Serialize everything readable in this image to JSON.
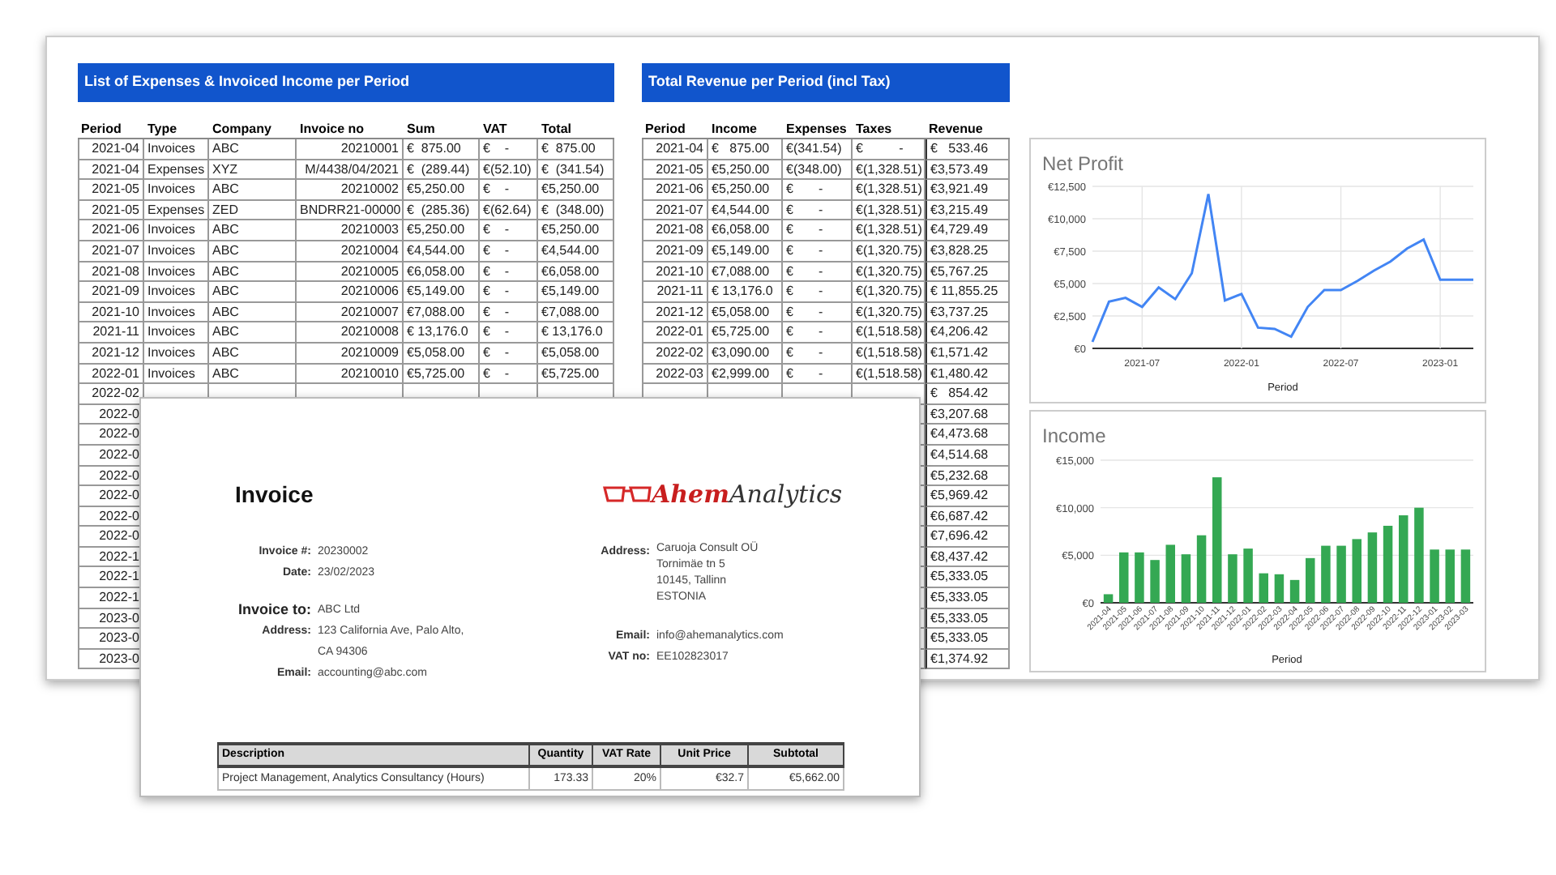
{
  "expenses": {
    "title": "List of Expenses & Invoiced Income per Period",
    "columns": [
      "Period",
      "Type",
      "Company",
      "Invoice no",
      "Sum",
      "VAT",
      "Total"
    ],
    "rows": [
      [
        "2021-04",
        "Invoices",
        "ABC",
        "20210001",
        "€  875.00",
        "€    -",
        "€  875.00"
      ],
      [
        "2021-04",
        "Expenses",
        "XYZ",
        "M/4438/04/2021",
        "€  (289.44)",
        "€(52.10)",
        "€  (341.54)"
      ],
      [
        "2021-05",
        "Invoices",
        "ABC",
        "20210002",
        "€5,250.00",
        "€    -",
        "€5,250.00"
      ],
      [
        "2021-05",
        "Expenses",
        "ZED",
        "BNDRR21-00000",
        "€  (285.36)",
        "€(62.64)",
        "€  (348.00)"
      ],
      [
        "2021-06",
        "Invoices",
        "ABC",
        "20210003",
        "€5,250.00",
        "€    -",
        "€5,250.00"
      ],
      [
        "2021-07",
        "Invoices",
        "ABC",
        "20210004",
        "€4,544.00",
        "€    -",
        "€4,544.00"
      ],
      [
        "2021-08",
        "Invoices",
        "ABC",
        "20210005",
        "€6,058.00",
        "€    -",
        "€6,058.00"
      ],
      [
        "2021-09",
        "Invoices",
        "ABC",
        "20210006",
        "€5,149.00",
        "€    -",
        "€5,149.00"
      ],
      [
        "2021-10",
        "Invoices",
        "ABC",
        "20210007",
        "€7,088.00",
        "€    -",
        "€7,088.00"
      ],
      [
        "2021-11",
        "Invoices",
        "ABC",
        "20210008",
        "€ 13,176.0",
        "€    -",
        "€ 13,176.0"
      ],
      [
        "2021-12",
        "Invoices",
        "ABC",
        "20210009",
        "€5,058.00",
        "€    -",
        "€5,058.00"
      ],
      [
        "2022-01",
        "Invoices",
        "ABC",
        "20210010",
        "€5,725.00",
        "€    -",
        "€5,725.00"
      ]
    ],
    "tail_periods": [
      "2022-02",
      "2022-0",
      "2022-0",
      "2022-0",
      "2022-0",
      "2022-0",
      "2022-0",
      "2022-0",
      "2022-1",
      "2022-1",
      "2022-1",
      "2023-0",
      "2023-0",
      "2023-0"
    ]
  },
  "revenue": {
    "title": "Total Revenue per Period (incl Tax)",
    "columns": [
      "Period",
      "Income",
      "Expenses",
      "Taxes",
      "Revenue"
    ],
    "rows": [
      [
        "2021-04",
        "€   875.00",
        "€(341.54)",
        "€          -",
        "€   533.46"
      ],
      [
        "2021-05",
        "€5,250.00",
        "€(348.00)",
        "€(1,328.51)",
        "€3,573.49"
      ],
      [
        "2021-06",
        "€5,250.00",
        "€       -",
        "€(1,328.51)",
        "€3,921.49"
      ],
      [
        "2021-07",
        "€4,544.00",
        "€       -",
        "€(1,328.51)",
        "€3,215.49"
      ],
      [
        "2021-08",
        "€6,058.00",
        "€       -",
        "€(1,328.51)",
        "€4,729.49"
      ],
      [
        "2021-09",
        "€5,149.00",
        "€       -",
        "€(1,320.75)",
        "€3,828.25"
      ],
      [
        "2021-10",
        "€7,088.00",
        "€       -",
        "€(1,320.75)",
        "€5,767.25"
      ],
      [
        "2021-11",
        "€ 13,176.0",
        "€       -",
        "€(1,320.75)",
        "€ 11,855.25"
      ],
      [
        "2021-12",
        "€5,058.00",
        "€       -",
        "€(1,320.75)",
        "€3,737.25"
      ],
      [
        "2022-01",
        "€5,725.00",
        "€       -",
        "€(1,518.58)",
        "€4,206.42"
      ],
      [
        "2022-02",
        "€3,090.00",
        "€       -",
        "€(1,518.58)",
        "€1,571.42"
      ],
      [
        "2022-03",
        "€2,999.00",
        "€       -",
        "€(1,518.58)",
        "€1,480.42"
      ]
    ],
    "tail_revenues": [
      "€   854.42",
      "€3,207.68",
      "€4,473.68",
      "€4,514.68",
      "€5,232.68",
      "€5,969.42",
      "€6,687.42",
      "€7,696.42",
      "€8,437.42",
      "€5,333.05",
      "€5,333.05",
      "€5,333.05",
      "€5,333.05",
      "€1,374.92"
    ]
  },
  "charts": [
    {
      "chart_data": {
        "type": "line",
        "grid": true,
        "title": "Net Profit",
        "xlabel": "Period",
        "categories": [
          null,
          null,
          null,
          "2021-07",
          null,
          null,
          null,
          null,
          null,
          "2022-01",
          null,
          null,
          null,
          null,
          null,
          "2022-07",
          null,
          null,
          null,
          null,
          null,
          "2023-01",
          null,
          null
        ],
        "series": [
          {
            "color": "#4285f4",
            "values": [
              500,
              3600,
              3900,
              3200,
              4700,
              3800,
              5800,
              11900,
              3700,
              4200,
              1600,
              1500,
              900,
              3200,
              4500,
              4500,
              5200,
              6000,
              6700,
              7700,
              8400,
              5300,
              5300,
              5300
            ]
          }
        ],
        "ylim": [
          0,
          12500
        ],
        "yticks": [
          {
            "value": 0,
            "label": "€0"
          },
          {
            "value": 2500,
            "label": "€2,500"
          },
          {
            "value": 5000,
            "label": "€5,000"
          },
          {
            "value": 7500,
            "label": "€7,500"
          },
          {
            "value": 10000,
            "label": "€10,000"
          },
          {
            "value": 12500,
            "label": "€12,500"
          }
        ]
      }
    },
    {
      "chart_data": {
        "type": "bar",
        "grid": true,
        "title": "Income",
        "xlabel": "Period",
        "categories": [
          "2021-04",
          "2021-05",
          "2021-06",
          "2021-07",
          "2021-08",
          "2021-09",
          "2021-10",
          "2021-11",
          "2021-12",
          "2022-01",
          "2022-02",
          "2022-03",
          "2022-04",
          "2022-05",
          "2022-06",
          "2022-07",
          "2022-08",
          "2022-09",
          "2022-10",
          "2022-11",
          "2022-12",
          "2023-01",
          "2023-02",
          "2023-03"
        ],
        "series": [
          {
            "color": "#34a853",
            "values": [
              900,
              5300,
              5300,
              4500,
              6100,
              5100,
              7100,
              13200,
              5100,
              5700,
              3100,
              3000,
              2400,
              4700,
              6000,
              6000,
              6700,
              7400,
              8100,
              9200,
              10000,
              5600,
              5600,
              5600
            ]
          }
        ],
        "ylim": [
          0,
          15000
        ],
        "yticks": [
          {
            "value": 0,
            "label": "€0"
          },
          {
            "value": 5000,
            "label": "€5,000"
          },
          {
            "value": 10000,
            "label": "€10,000"
          },
          {
            "value": 15000,
            "label": "€15,000"
          }
        ]
      }
    }
  ],
  "invoice": {
    "title": "Invoice",
    "logo": {
      "accent": "Ahem",
      "rest": "Analytics"
    },
    "meta": [
      {
        "label": "Invoice #:",
        "value": "20230002"
      },
      {
        "label": "Date:",
        "value": "23/02/2023"
      }
    ],
    "bill_to": {
      "label": "Invoice to:",
      "value": "ABC Ltd"
    },
    "client": [
      {
        "label": "Address:",
        "lines": [
          "123 California Ave, Palo Alto,",
          "CA 94306"
        ]
      },
      {
        "label": "Email:",
        "lines": [
          "accounting@abc.com"
        ]
      }
    ],
    "sender": [
      {
        "label": "Address:",
        "lines": [
          "Caruoja Consult OÜ",
          "Tornimäe tn 5",
          "10145, Tallinn",
          "ESTONIA"
        ]
      },
      {
        "label": "Email:",
        "lines": [
          "info@ahemanalytics.com"
        ]
      },
      {
        "label": "VAT no:",
        "lines": [
          "EE102823017"
        ]
      }
    ],
    "items": {
      "columns": [
        "Description",
        "Quantity",
        "VAT Rate",
        "Unit Price",
        "Subtotal"
      ],
      "rows": [
        [
          "Project Management, Analytics Consultancy (Hours)",
          "173.33",
          "20%",
          "€32.7",
          "€5,662.00"
        ]
      ]
    }
  }
}
